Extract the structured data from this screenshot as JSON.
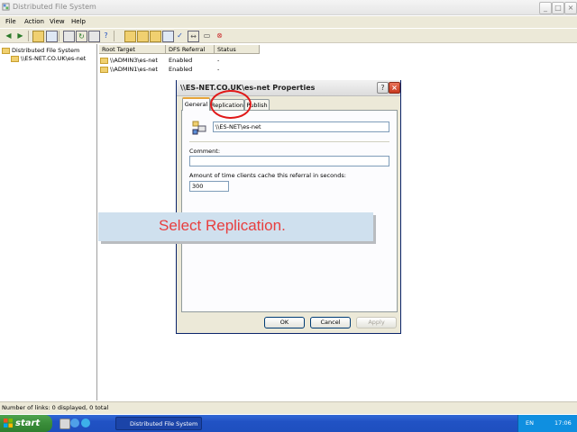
{
  "window": {
    "title": "Distributed File System",
    "app_icon": "dfs-icon",
    "controls": {
      "minimize": "_",
      "maximize": "□",
      "close": "×"
    }
  },
  "menu": {
    "file": "File",
    "action": "Action",
    "view": "View",
    "help": "Help"
  },
  "toolbar": {
    "icons": [
      "back-icon",
      "forward-icon",
      "up-icon",
      "show-tree-icon",
      "properties-icon",
      "refresh-icon",
      "export-icon",
      "new-root-icon",
      "new-link-icon",
      "new-target-icon",
      "delete-icon",
      "check-status-icon",
      "replication-icon",
      "open-icon",
      "help-icon"
    ]
  },
  "tree": {
    "root_label": "Distributed File System",
    "child_label": "\\\\ES-NET.CO.UK\\es-net"
  },
  "list": {
    "columns": [
      "Root Target",
      "DFS Referral",
      "Status"
    ],
    "rows": [
      {
        "target": "\\\\ADMIN3\\es-net",
        "referral": "Enabled",
        "status": "-"
      },
      {
        "target": "\\\\ADMIN1\\es-net",
        "referral": "Enabled",
        "status": "-"
      }
    ]
  },
  "status_bar": {
    "text": "Number of links: 0 displayed, 0 total"
  },
  "taskbar": {
    "start_label": "start",
    "task_label": "Distributed File System",
    "lang": "EN",
    "clock": "17:06"
  },
  "dialog": {
    "title": "\\\\ES-NET.CO.UK\\es-net Properties",
    "help_glyph": "?",
    "close_glyph": "×",
    "tabs": [
      "General",
      "Replication",
      "Publish"
    ],
    "active_tab": "General",
    "path_value": "\\\\ES-NET\\es-net",
    "comment_label": "Comment:",
    "comment_value": "",
    "cache_label": "Amount of time clients cache this referral in seconds:",
    "cache_value": "300",
    "ok_label": "OK",
    "cancel_label": "Cancel",
    "apply_label": "Apply"
  },
  "overlay": {
    "instruction": "Select Replication.",
    "highlight_color": "#e01818"
  },
  "colors": {
    "taskbar_blue": "#2152c4",
    "start_green": "#3a8d3a",
    "dialog_face": "#ece9d8"
  }
}
